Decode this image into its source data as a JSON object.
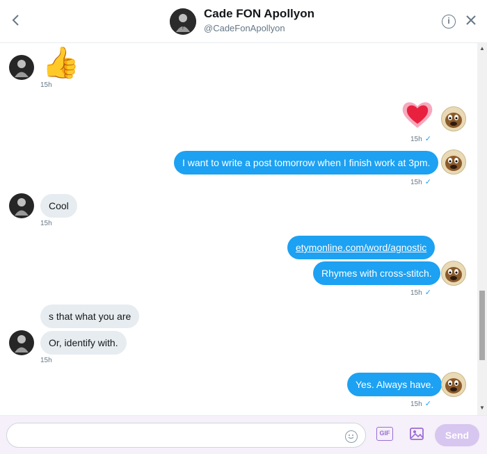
{
  "header": {
    "name": "Cade FON Apollyon",
    "handle": "@CadeFonApollyon",
    "back_icon": "chevron-left-icon",
    "info_icon": "info-icon",
    "close_icon": "close-icon"
  },
  "messages": [
    {
      "from": "them",
      "type": "emoji",
      "emoji": "👍",
      "time": "15h"
    },
    {
      "from": "me",
      "type": "emoji",
      "emoji": "heart",
      "time": "15h"
    },
    {
      "from": "me",
      "text": "I want to write a post tomorrow when I finish work at 3pm.",
      "time": "15h"
    },
    {
      "from": "them",
      "text": "Cool",
      "time": "15h"
    },
    {
      "from": "me",
      "text": "etymonline.com/word/agnostic",
      "link": true
    },
    {
      "from": "me",
      "text": "Rhymes with cross-stitch.",
      "time": "15h"
    },
    {
      "from": "them",
      "text": "s that what you are"
    },
    {
      "from": "them",
      "text": "Or, identify with.",
      "time": "15h"
    },
    {
      "from": "me",
      "text": "Yes. Always have.",
      "time": "15h"
    }
  ],
  "composer": {
    "placeholder": "",
    "gif_label": "GIF",
    "send_label": "Send"
  },
  "colors": {
    "accent": "#1da1f2",
    "incoming_bubble": "#e6ecf0",
    "send_disabled": "#d7c6ef"
  }
}
